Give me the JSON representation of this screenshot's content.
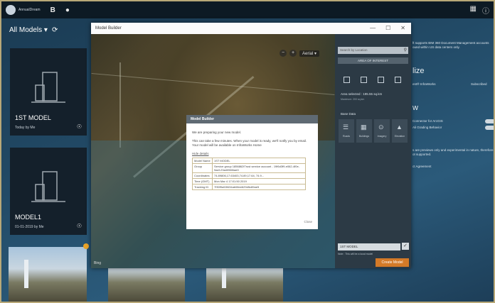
{
  "app": {
    "user_name": "AnnualDream",
    "top_glyph": "B",
    "refresh_glyph": "⟳"
  },
  "sidebar": {
    "title": "All Models",
    "models": [
      {
        "name": "1ST MODEL",
        "sub": "Today by Me"
      },
      {
        "name": "MODEL1",
        "sub": "01-01-2019 by Me"
      }
    ]
  },
  "behind_text": {
    "line1": "ft supports BIM 360 Document Management accounts",
    "line2": "ound within US data centers only.",
    "heading1": "lize",
    "infraworks": "ent® InfraWorks",
    "subscribed": "Subscribed",
    "heading2": "w",
    "connector": "Connector for ArcGIS",
    "grading": "Ali Grading Behavior",
    "preview1": "s are previews only and experimental in nature, therefore",
    "preview2": "ot supported.",
    "agreement": "ct Agreement"
  },
  "window": {
    "title": "Model Builder",
    "minimize": "—",
    "maximize": "☐",
    "close": "✕",
    "map_style": "Aerial",
    "map_credit": "Bing"
  },
  "panel": {
    "search_placeholder": "Search by Location",
    "aoi_label": "AREA OF INTEREST",
    "area_selected": "Area selected : 195.55 sq.km",
    "area_max": "Maximum: 200 sq.km",
    "base_data_label": "Base Data",
    "base_data": [
      {
        "label": "Roads",
        "glyph": "☰"
      },
      {
        "label": "Buildings",
        "glyph": "▦"
      },
      {
        "label": "Imagery",
        "glyph": "⊙"
      },
      {
        "label": "Elevation",
        "glyph": "▲"
      }
    ],
    "model_name": "1ST MODEL",
    "note": "Note : This will be a local model",
    "create_label": "Create Model"
  },
  "dialog": {
    "title": "Model Builder",
    "p1": "We are preparing your new model.",
    "p2": "This can take a few minutes. When your model is ready, we'll notify you by email. Your model will be available on InfraWorks Home",
    "hide_details": "Hide details",
    "rows": [
      {
        "k": "Model Name",
        "v": "1ST MODEL"
      },
      {
        "k": "Group",
        "v": "Service group 1856862f7rust service account - 19f6d3f9-e062-4f0e-9aef-23a4056f4ae0"
      },
      {
        "k": "Coordinates",
        "v": "74.89806,17.63403,74.89,17.64, 74.9..."
      },
      {
        "k": "Time (GMT)",
        "v": "Mon Mar 4 17:01:50 2019"
      },
      {
        "k": "Tracking ID",
        "v": "7f30f9a53f434ab08ee629d5c89ae5"
      }
    ],
    "close_label": "Close"
  }
}
